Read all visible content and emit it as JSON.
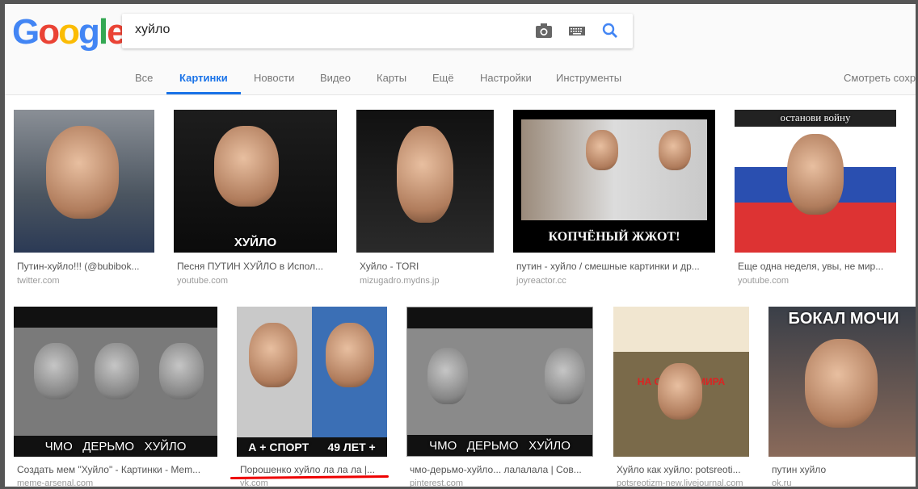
{
  "logo": {
    "letters": [
      "G",
      "o",
      "o",
      "g",
      "l",
      "e"
    ],
    "colors": [
      "#4285f4",
      "#ea4335",
      "#fbbc05",
      "#4285f4",
      "#34a853",
      "#ea4335"
    ]
  },
  "search": {
    "value": "хуйло"
  },
  "tabs": [
    {
      "label": "Все"
    },
    {
      "label": "Картинки"
    },
    {
      "label": "Новости"
    },
    {
      "label": "Видео"
    },
    {
      "label": "Карты"
    },
    {
      "label": "Ещё"
    },
    {
      "label": "Настройки"
    },
    {
      "label": "Инструменты"
    }
  ],
  "saved_label": "Смотреть сохр",
  "results": [
    {
      "caption": "Путин-хуйло!!! (@bubibok...",
      "source": "twitter.com",
      "overlay": ""
    },
    {
      "caption": "Песня ПУТИН ХУЙЛО в Испол...",
      "source": "youtube.com",
      "overlay": "ХУЙЛО"
    },
    {
      "caption": "Хуйло - TORI",
      "source": "mizugadro.mydns.jp",
      "overlay": ""
    },
    {
      "caption": "путин - хуйло / смешные картинки и др...",
      "source": "joyreactor.cc",
      "overlay": "КОПЧЁНЫЙ ЖЖОТ!"
    },
    {
      "caption": "Еще одна неделя, увы, не мир...",
      "source": "youtube.com",
      "overlay": "останови войну"
    },
    {
      "caption": "Создать мем \"Хуйло\" - Картинки - Mem...",
      "source": "meme-arsenal.com",
      "overlay": "ЧМО   ДЕРЬМО   ХУЙЛО"
    },
    {
      "caption": "Порошенко хуйло ла ла ла |...",
      "source": "vk.com",
      "overlay": "А + СПОРТ      49 ЛЕТ +"
    },
    {
      "caption": "чмо-дерьмо-хуйло... лалалала | Сов...",
      "source": "pinterest.com",
      "overlay": "ЧМО   ДЕРЬМО   ХУЙЛО"
    },
    {
      "caption": "Хуйло как хуйло: potsreoti...",
      "source": "potsreotizm-new.livejournal.com",
      "overlay": "НА СТРАЖЕ МИРА"
    },
    {
      "caption": "путин хуйло",
      "source": "ok.ru",
      "overlay": "БОКАЛ МОЧИ"
    }
  ],
  "colors": {
    "accent": "#1a73e8",
    "underline": "#e00000"
  }
}
